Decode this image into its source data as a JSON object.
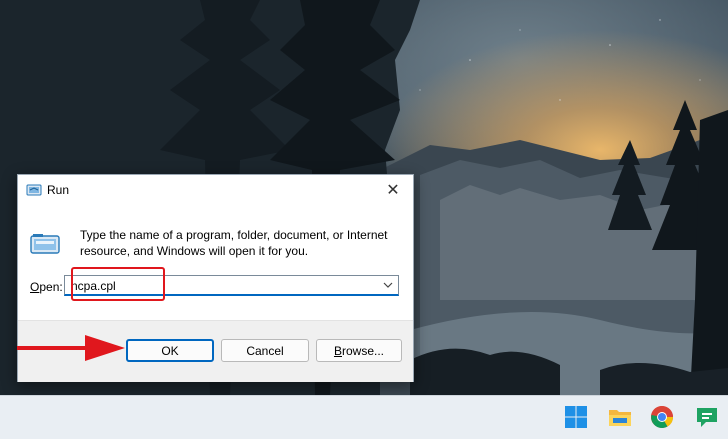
{
  "run_dialog": {
    "title": "Run",
    "close_glyph": "✕",
    "description": "Type the name of a program, folder, document, or Internet resource, and Windows will open it for you.",
    "open_label_accel": "O",
    "open_label_rest": "pen:",
    "open_value": "ncpa.cpl",
    "ok_label": "OK",
    "cancel_label": "Cancel",
    "browse_label_accel": "B",
    "browse_label_rest": "rowse...",
    "title_icon": "run-icon",
    "body_icon": "run-icon"
  },
  "taskbar": {
    "icons": [
      "windows-start-icon",
      "file-explorer-icon",
      "chrome-icon",
      "chat-icon"
    ]
  },
  "annotations": {
    "highlight_color": "#e0171d",
    "arrow_color": "#e0171d"
  },
  "colors": {
    "accent": "#0067c0",
    "taskbar_bg": "#e9eef3"
  }
}
